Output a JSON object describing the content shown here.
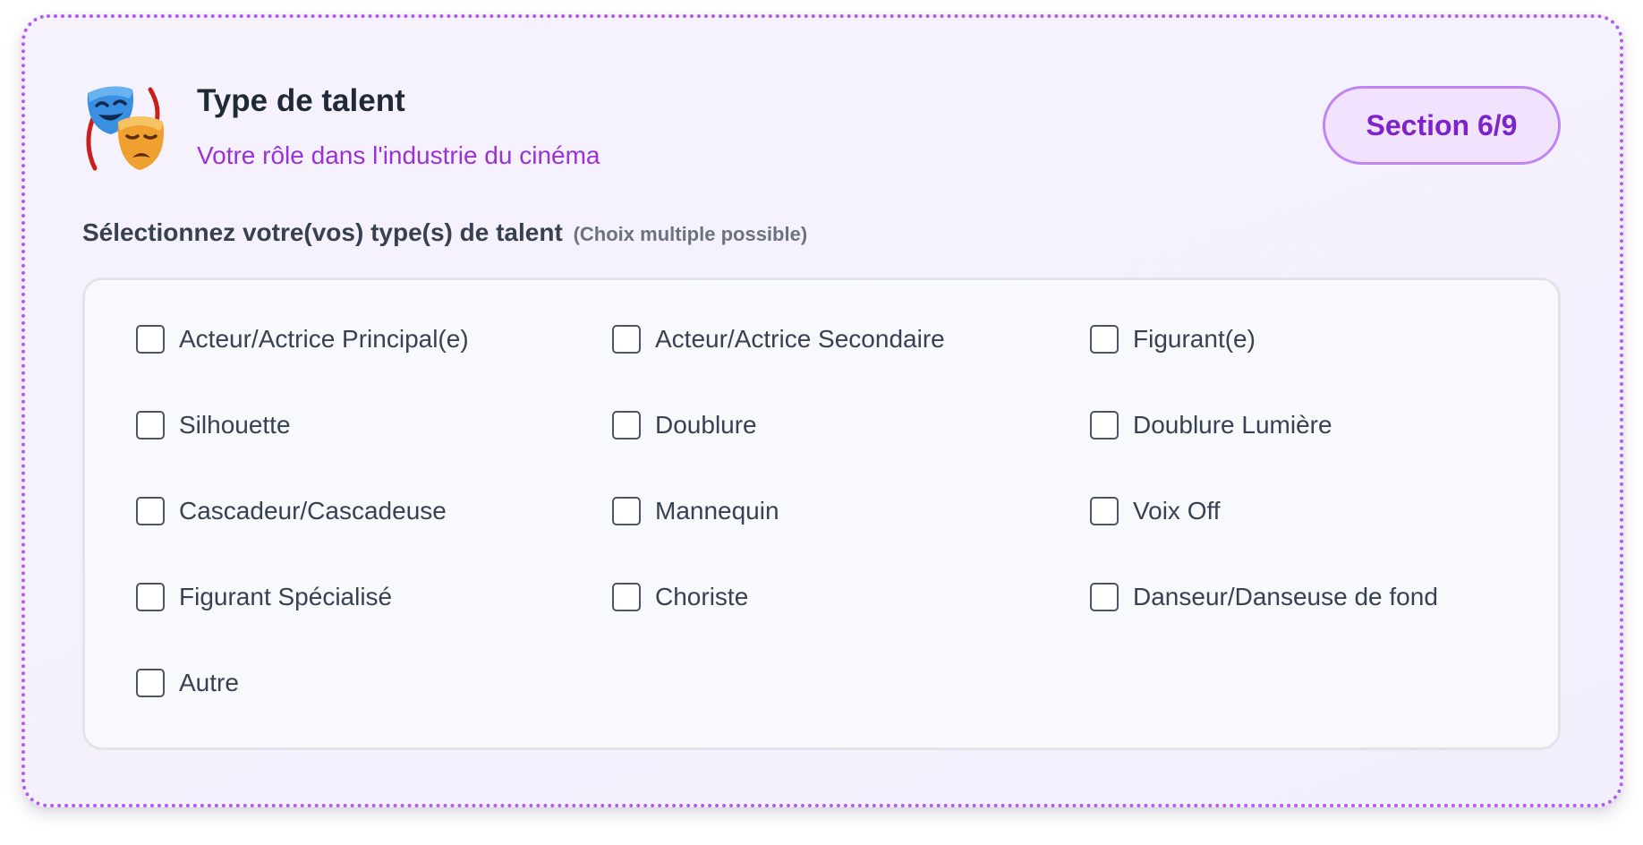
{
  "header": {
    "icon": "performing-arts-masks-icon",
    "title": "Type de talent",
    "subtitle": "Votre rôle dans l'industrie du cinéma",
    "section_badge": "Section 6/9"
  },
  "question": {
    "label": "Sélectionnez votre(vos) type(s) de talent",
    "hint": "(Choix multiple possible)"
  },
  "options": [
    {
      "label": "Acteur/Actrice Principal(e)",
      "checked": false
    },
    {
      "label": "Acteur/Actrice Secondaire",
      "checked": false
    },
    {
      "label": "Figurant(e)",
      "checked": false
    },
    {
      "label": "Silhouette",
      "checked": false
    },
    {
      "label": "Doublure",
      "checked": false
    },
    {
      "label": "Doublure Lumière",
      "checked": false
    },
    {
      "label": "Cascadeur/Cascadeuse",
      "checked": false
    },
    {
      "label": "Mannequin",
      "checked": false
    },
    {
      "label": "Voix Off",
      "checked": false
    },
    {
      "label": "Figurant Spécialisé",
      "checked": false
    },
    {
      "label": "Choriste",
      "checked": false
    },
    {
      "label": "Danseur/Danseuse de fond",
      "checked": false
    },
    {
      "label": "Autre",
      "checked": false
    }
  ],
  "colors": {
    "accent": "#9b30d9",
    "badge_text": "#7e22ce",
    "border_dotted": "#b15cf0"
  }
}
